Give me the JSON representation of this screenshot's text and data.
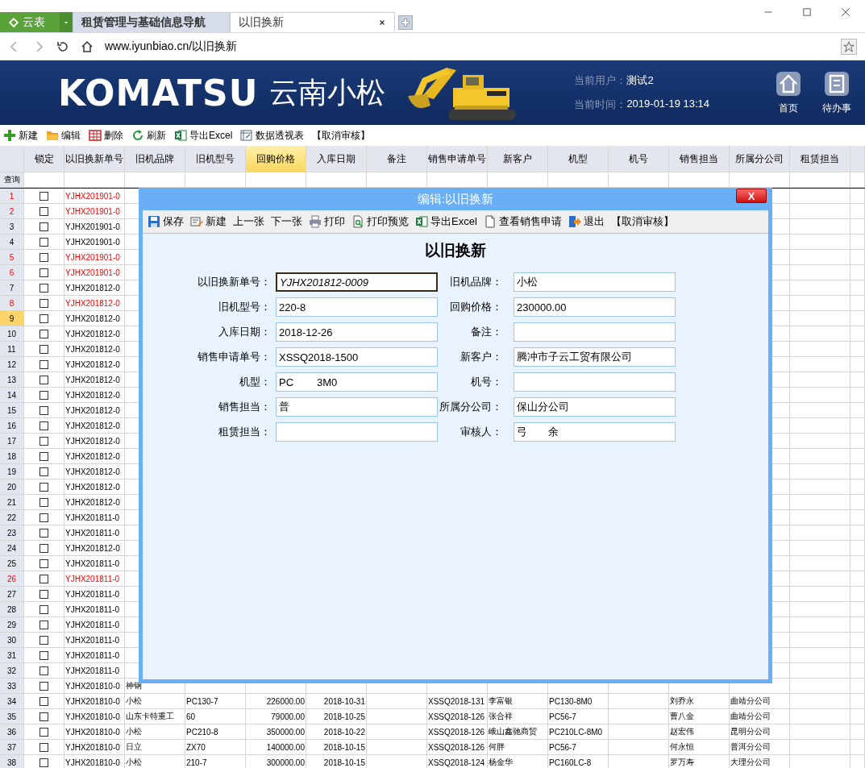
{
  "browser": {
    "tabs": [
      {
        "label": "云表",
        "kind": "app",
        "selected": false
      },
      {
        "label": "租赁管理与基础信息导航",
        "kind": "page",
        "selected": false
      },
      {
        "label": "以旧换新",
        "kind": "page",
        "selected": true
      }
    ],
    "url": "www.iyunbiao.cn/以旧换新"
  },
  "banner": {
    "logo": "KOMATSU",
    "company": "云南小松",
    "user_label": "当前用户：",
    "user": "测试2",
    "time_label": "当前时间：",
    "time": "2019-01-19 13:14",
    "nav": [
      "首页",
      "待办事"
    ]
  },
  "toolbar": [
    "新建",
    "编辑",
    "删除",
    "刷新",
    "导出Excel",
    "数据透视表",
    "【取消审核】"
  ],
  "table": {
    "lock_header": "锁定",
    "columns": [
      {
        "label": "以旧换新单号",
        "selected": false
      },
      {
        "label": "旧机品牌",
        "selected": false
      },
      {
        "label": "旧机型号",
        "selected": false
      },
      {
        "label": "回购价格",
        "selected": true
      },
      {
        "label": "入库日期",
        "selected": false
      },
      {
        "label": "备注",
        "selected": false
      },
      {
        "label": "销售申请单号",
        "selected": false
      },
      {
        "label": "新客户",
        "selected": false
      },
      {
        "label": "机型",
        "selected": false
      },
      {
        "label": "机号",
        "selected": false
      },
      {
        "label": "销售担当",
        "selected": false
      },
      {
        "label": "所属分公司",
        "selected": false
      },
      {
        "label": "租赁担当",
        "selected": false
      }
    ],
    "query_label": "查询",
    "rows": [
      {
        "n": "1",
        "color": "#ff0000",
        "selected": false,
        "locked": false,
        "cells": [
          "YJHX201901-0"
        ]
      },
      {
        "n": "2",
        "color": "#ff0000",
        "selected": false,
        "locked": false,
        "cells": [
          "YJHX201901-0"
        ]
      },
      {
        "n": "3",
        "color": "#000000",
        "selected": false,
        "locked": false,
        "cells": [
          "YJHX201901-0"
        ]
      },
      {
        "n": "4",
        "color": "#000000",
        "selected": false,
        "locked": false,
        "cells": [
          "YJHX201901-0"
        ]
      },
      {
        "n": "5",
        "color": "#ff0000",
        "selected": false,
        "locked": false,
        "cells": [
          "YJHX201901-0"
        ]
      },
      {
        "n": "6",
        "color": "#ff0000",
        "selected": false,
        "locked": false,
        "cells": [
          "YJHX201901-0"
        ]
      },
      {
        "n": "7",
        "color": "#000000",
        "selected": false,
        "locked": false,
        "cells": [
          "YJHX201812-0"
        ]
      },
      {
        "n": "8",
        "color": "#ff0000",
        "selected": false,
        "locked": false,
        "cells": [
          "YJHX201812-0"
        ]
      },
      {
        "n": "9",
        "color": "#000000",
        "selected": true,
        "locked": false,
        "cells": [
          "YJHX201812-0"
        ]
      },
      {
        "n": "10",
        "color": "#000000",
        "selected": false,
        "locked": false,
        "cells": [
          "YJHX201812-0"
        ]
      },
      {
        "n": "11",
        "color": "#000000",
        "selected": false,
        "locked": false,
        "cells": [
          "YJHX201812-0"
        ]
      },
      {
        "n": "12",
        "color": "#000000",
        "selected": false,
        "locked": false,
        "cells": [
          "YJHX201812-0"
        ]
      },
      {
        "n": "13",
        "color": "#000000",
        "selected": false,
        "locked": false,
        "cells": [
          "YJHX201812-0"
        ]
      },
      {
        "n": "14",
        "color": "#000000",
        "selected": false,
        "locked": false,
        "cells": [
          "YJHX201812-0"
        ]
      },
      {
        "n": "15",
        "color": "#000000",
        "selected": false,
        "locked": false,
        "cells": [
          "YJHX201812-0"
        ]
      },
      {
        "n": "16",
        "color": "#000000",
        "selected": false,
        "locked": false,
        "cells": [
          "YJHX201812-0"
        ]
      },
      {
        "n": "17",
        "color": "#000000",
        "selected": false,
        "locked": false,
        "cells": [
          "YJHX201812-0"
        ]
      },
      {
        "n": "18",
        "color": "#000000",
        "selected": false,
        "locked": false,
        "cells": [
          "YJHX201812-0"
        ]
      },
      {
        "n": "19",
        "color": "#000000",
        "selected": false,
        "locked": false,
        "cells": [
          "YJHX201812-0"
        ]
      },
      {
        "n": "20",
        "color": "#000000",
        "selected": false,
        "locked": false,
        "cells": [
          "YJHX201812-0"
        ]
      },
      {
        "n": "21",
        "color": "#000000",
        "selected": false,
        "locked": false,
        "cells": [
          "YJHX201812-0"
        ]
      },
      {
        "n": "22",
        "color": "#000000",
        "selected": false,
        "locked": false,
        "cells": [
          "YJHX201811-0"
        ]
      },
      {
        "n": "23",
        "color": "#000000",
        "selected": false,
        "locked": false,
        "cells": [
          "YJHX201811-0"
        ]
      },
      {
        "n": "24",
        "color": "#000000",
        "selected": false,
        "locked": false,
        "cells": [
          "YJHX201812-0"
        ]
      },
      {
        "n": "25",
        "color": "#000000",
        "selected": false,
        "locked": false,
        "cells": [
          "YJHX201811-0"
        ]
      },
      {
        "n": "26",
        "color": "#ff0000",
        "selected": false,
        "locked": false,
        "cells": [
          "YJHX201811-0"
        ]
      },
      {
        "n": "27",
        "color": "#000000",
        "selected": false,
        "locked": false,
        "cells": [
          "YJHX201811-0"
        ]
      },
      {
        "n": "28",
        "color": "#000000",
        "selected": false,
        "locked": false,
        "cells": [
          "YJHX201811-0"
        ]
      },
      {
        "n": "29",
        "color": "#000000",
        "selected": false,
        "locked": false,
        "cells": [
          "YJHX201811-0"
        ]
      },
      {
        "n": "30",
        "color": "#000000",
        "selected": false,
        "locked": false,
        "cells": [
          "YJHX201811-0"
        ]
      },
      {
        "n": "31",
        "color": "#000000",
        "selected": false,
        "locked": false,
        "cells": [
          "YJHX201811-0"
        ]
      },
      {
        "n": "32",
        "color": "#000000",
        "selected": false,
        "locked": false,
        "cells": [
          "YJHX201811-0"
        ]
      },
      {
        "n": "33",
        "color": "#000000",
        "selected": false,
        "locked": false,
        "cells": [
          "YJHX201810-0",
          "神钢"
        ]
      },
      {
        "n": "34",
        "color": "#000000",
        "selected": false,
        "locked": false,
        "cells": [
          "YJHX201810-0",
          "小松",
          "PC130-7",
          "226000.00",
          "2018-10-31",
          "",
          "XSSQ2018-131",
          "李富银",
          "PC130-8M0",
          "",
          "刘乔永",
          "曲靖分公司"
        ]
      },
      {
        "n": "35",
        "color": "#000000",
        "selected": false,
        "locked": false,
        "cells": [
          "YJHX201810-0",
          "山东卡特重工",
          "60",
          "79000.00",
          "2018-10-25",
          "",
          "XSSQ2018-126",
          "张合祥",
          "PC56-7",
          "",
          "曹八金",
          "曲靖分公司"
        ]
      },
      {
        "n": "36",
        "color": "#000000",
        "selected": false,
        "locked": false,
        "cells": [
          "YJHX201810-0",
          "小松",
          "PC210-8",
          "350000.00",
          "2018-10-22",
          "",
          "XSSQ2018-126",
          "峨山鑫驰商贸",
          "PC210LC-8M0",
          "",
          "赵宏伟",
          "昆明分公司"
        ]
      },
      {
        "n": "37",
        "color": "#000000",
        "selected": false,
        "locked": false,
        "cells": [
          "YJHX201810-0",
          "日立",
          "ZX70",
          "140000.00",
          "2018-10-15",
          "",
          "XSSQ2018-126",
          "何胖",
          "PC56-7",
          "",
          "何永恒",
          "普洱分公司"
        ]
      },
      {
        "n": "38",
        "color": "#000000",
        "selected": false,
        "locked": false,
        "cells": [
          "YJHX201810-0",
          "小松",
          "210-7",
          "300000.00",
          "2018-10-15",
          "",
          "XSSQ2018-124",
          "杨金华",
          "PC160LC-8",
          "",
          "罗万寿",
          "大理分公司"
        ]
      }
    ]
  },
  "dialog": {
    "title": "编辑:以旧换新",
    "close": "X",
    "toolbar": [
      "保存",
      "新建",
      "上一张",
      "下一张",
      "打印",
      "打印预览",
      "导出Excel",
      "查看销售申请",
      "退出",
      "【取消审核】"
    ],
    "heading": "以旧换新",
    "fields": [
      {
        "label": "以旧换新单号：",
        "value": "YJHX201812-0009",
        "focused": true
      },
      {
        "label": "旧机品牌：",
        "value": "小松",
        "focused": false
      },
      {
        "label": "旧机型号：",
        "value": "220-8",
        "focused": false
      },
      {
        "label": "回购价格：",
        "value": "230000.00",
        "focused": false
      },
      {
        "label": "入库日期：",
        "value": "2018-12-26",
        "focused": false
      },
      {
        "label": "备注：",
        "focused": false
      },
      {
        "label": "销售申请单号：",
        "value": "XSSQ2018-1500",
        "focused": false
      },
      {
        "label": "新客户：",
        "value": "腾冲市子云工贸有限公司",
        "focused": false
      },
      {
        "label": "机型：",
        "value": "PC        3M0",
        "focused": false
      },
      {
        "label": "机号：",
        "focused": false
      },
      {
        "label": "销售担当：",
        "value": "普",
        "focused": false
      },
      {
        "label": "所属分公司：",
        "value": "保山分公司",
        "focused": false
      },
      {
        "label": "租赁担当：",
        "focused": false
      },
      {
        "label": "审核人：",
        "value": "弓　　余",
        "focused": false
      }
    ]
  }
}
